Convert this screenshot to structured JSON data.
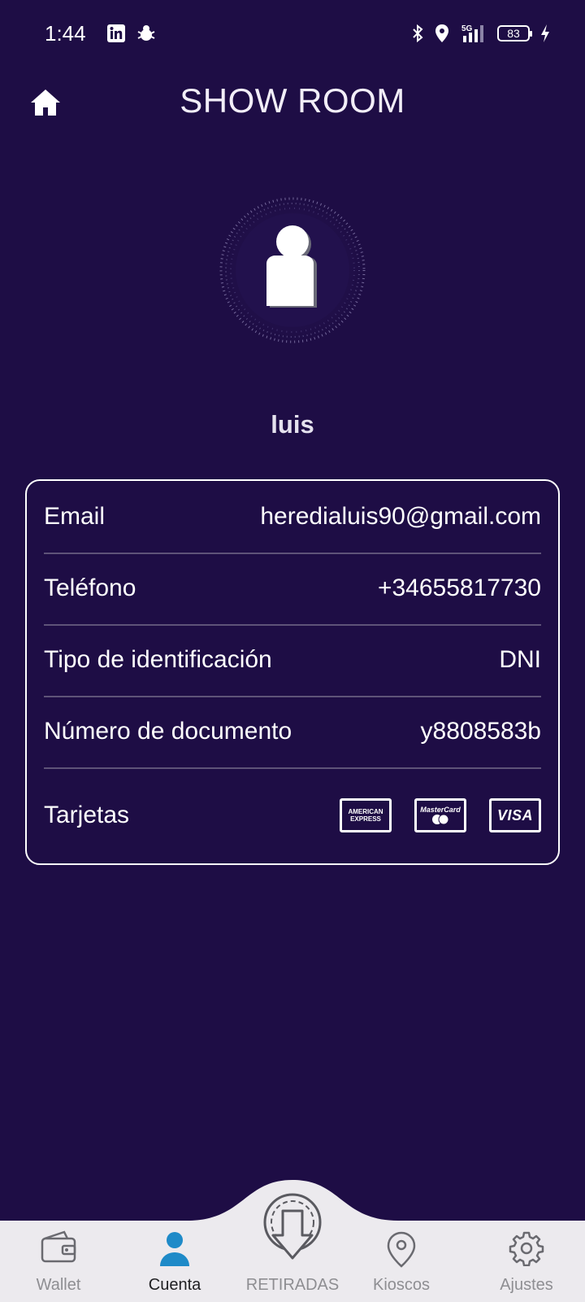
{
  "status_bar": {
    "time": "1:44",
    "battery": "83",
    "network": "5G",
    "left_icons": [
      "linkedin-icon",
      "bug-icon"
    ],
    "right_icons": [
      "bluetooth-icon",
      "location-icon",
      "signal-icon",
      "battery-icon",
      "charging-icon"
    ]
  },
  "header": {
    "title": "SHOW ROOM",
    "home_icon": "home-icon"
  },
  "profile": {
    "name": "luis",
    "avatar_icon": "user-avatar-icon"
  },
  "info": {
    "rows": [
      {
        "label": "Email",
        "value": "heredialuis90@gmail.com"
      },
      {
        "label": "Teléfono",
        "value": "+34655817730"
      },
      {
        "label": "Tipo de identificación",
        "value": "DNI"
      },
      {
        "label": "Número de documento",
        "value": "y8808583b"
      }
    ],
    "cards_label": "Tarjetas",
    "cards": {
      "amex_line1": "AMERICAN",
      "amex_line2": "EXPRESS",
      "mastercard": "MasterCard",
      "visa": "VISA"
    }
  },
  "nav": {
    "items": [
      {
        "label": "Wallet",
        "icon": "wallet-icon"
      },
      {
        "label": "Cuenta",
        "icon": "account-icon"
      },
      {
        "label": "RETIRADAS",
        "icon": "withdraw-icon"
      },
      {
        "label": "Kioscos",
        "icon": "location-pin-icon"
      },
      {
        "label": "Ajustes",
        "icon": "gear-icon"
      }
    ],
    "active": "Cuenta"
  },
  "colors": {
    "background": "#1e0d45",
    "nav_background": "#eceaee",
    "active_icon": "#1e8ac8"
  }
}
